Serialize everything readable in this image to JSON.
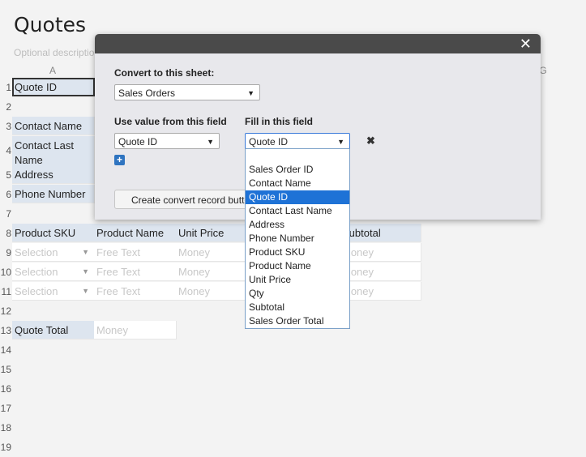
{
  "page": {
    "title": "Quotes",
    "description": "Optional description of this form"
  },
  "grid": {
    "columns": [
      "A",
      "G"
    ],
    "rows": [
      "1",
      "2",
      "3",
      "4",
      "5",
      "6",
      "7",
      "8",
      "9",
      "10",
      "11",
      "12",
      "13",
      "14",
      "15",
      "16",
      "17",
      "18",
      "19"
    ],
    "cells": {
      "quote_id": "Quote ID",
      "contact_name": "Contact Name",
      "contact_last_name": "Contact Last Name",
      "address": "Address",
      "phone_number": "Phone Number",
      "product_sku": "Product SKU",
      "product_name": "Product Name",
      "unit_price": "Unit Price",
      "subtotal": "Subtotal",
      "selection": "Selection",
      "free_text": "Free Text",
      "money": "Money",
      "quote_total": "Quote Total"
    }
  },
  "modal": {
    "convert_label": "Convert to this sheet:",
    "convert_value": "Sales Orders",
    "use_value_label": "Use value from this field",
    "use_value_value": "Quote ID",
    "fill_in_label": "Fill in this field",
    "fill_in_value": "Quote ID",
    "create_button": "Create convert record button",
    "fill_in_options": [
      "Sales Order ID",
      "Contact Name",
      "Quote ID",
      "Contact Last Name",
      "Address",
      "Phone Number",
      "Product SKU",
      "Product Name",
      "Unit Price",
      "Qty",
      "Subtotal",
      "Sales Order Total"
    ],
    "selected_option": "Quote ID"
  },
  "icons": {
    "close": "close-icon",
    "remove": "remove-icon",
    "add": "plus-icon"
  },
  "colors": {
    "label_cell": "#dde5ef",
    "modal_bar": "#4a4a4a",
    "selected_option": "#1e72d6",
    "add_icon": "#2f74c0"
  }
}
